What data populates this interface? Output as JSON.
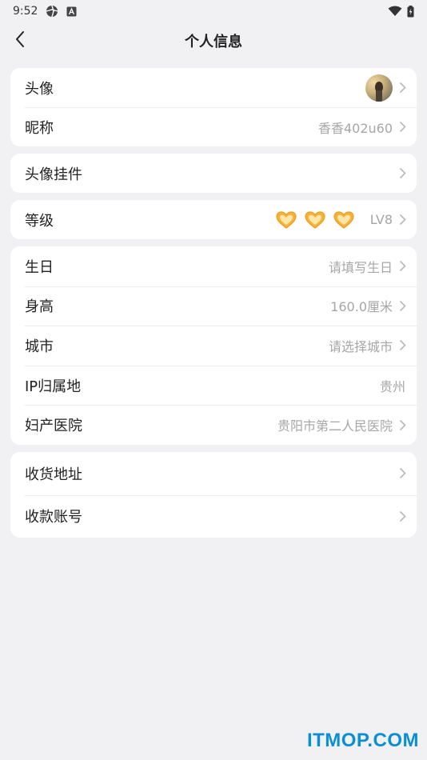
{
  "status_bar": {
    "time": "9:52",
    "icons_left": [
      "aperture-icon",
      "a-box-icon"
    ],
    "icons_right": [
      "wifi-icon",
      "battery-icon"
    ]
  },
  "header": {
    "back_icon": "chevron-left-icon",
    "title": "个人信息"
  },
  "sections": {
    "profile": {
      "avatar_label": "头像",
      "nickname_label": "昵称",
      "nickname_value": "香香402u60"
    },
    "pendant": {
      "label": "头像挂件"
    },
    "level": {
      "label": "等级",
      "hearts": 3,
      "value": "LV8"
    },
    "info": {
      "birthday_label": "生日",
      "birthday_value": "请填写生日",
      "height_label": "身高",
      "height_value": "160.0厘米",
      "city_label": "城市",
      "city_value": "请选择城市",
      "ip_label": "IP归属地",
      "ip_value": "贵州",
      "hospital_label": "妇产医院",
      "hospital_value": "贵阳市第二人民医院"
    },
    "finance": {
      "address_label": "收货地址",
      "account_label": "收款账号"
    }
  },
  "watermark": "ITMOP.COM",
  "colors": {
    "background": "#f1f1f4",
    "card": "#ffffff",
    "value_text": "#a6a6a6",
    "heart_gold": "#f5b53a",
    "watermark": "#0a8fd6"
  }
}
